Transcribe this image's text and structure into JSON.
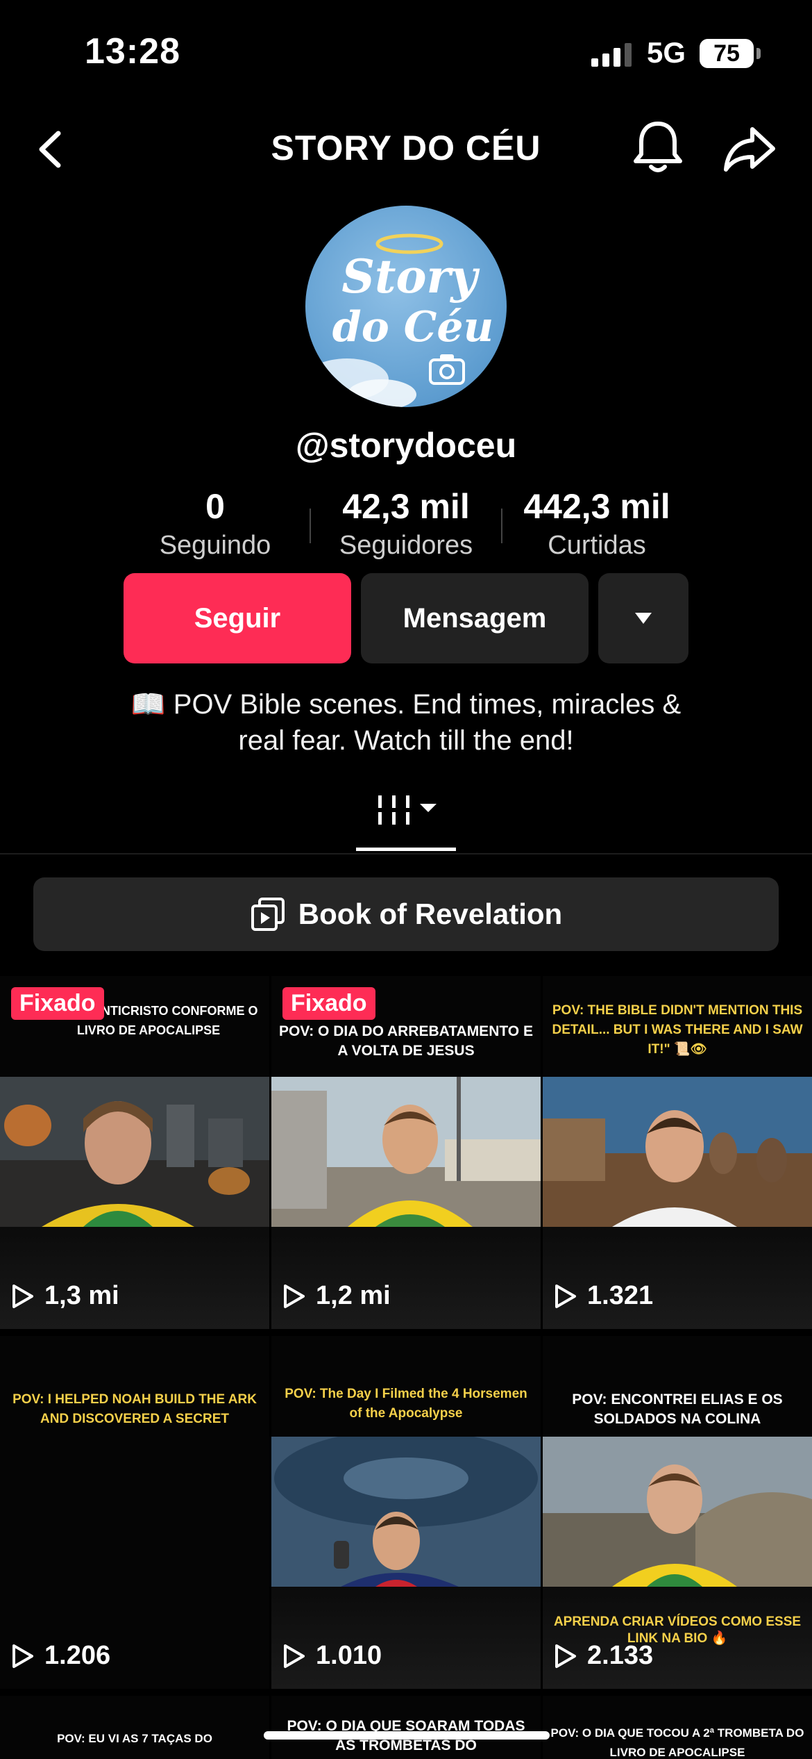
{
  "status_bar": {
    "time": "13:28",
    "network": "5G",
    "battery": "75"
  },
  "header": {
    "title": "STORY DO CÉU"
  },
  "profile": {
    "avatar_text_line1": "Story",
    "avatar_text_line2": "do Céu",
    "handle": "@storydoceu",
    "stats": [
      {
        "value": "0",
        "label": "Seguindo"
      },
      {
        "value": "42,3 mil",
        "label": "Seguidores"
      },
      {
        "value": "442,3 mil",
        "label": "Curtidas"
      }
    ],
    "follow_label": "Seguir",
    "message_label": "Mensagem",
    "bio_line1": "📖 POV Bible scenes. End times, miracles &",
    "bio_line2": "real fear. Watch till the end!"
  },
  "playlist": {
    "label": "Book of Revelation"
  },
  "videos": [
    {
      "pinned": "Fixado",
      "caption": "ADO DO ANTICRISTO CONFORME O LIVRO DE APOCALIPSE",
      "caption_color": "white",
      "views": "1,3 mi"
    },
    {
      "pinned": "Fixado",
      "caption": "POV: O DIA DO ARREBATAMENTO E A VOLTA DE JESUS",
      "caption_color": "white",
      "views": "1,2 mi"
    },
    {
      "pinned": "",
      "caption": "POV: THE BIBLE DIDN'T MENTION THIS DETAIL... BUT I WAS THERE AND I SAW IT!\" 📜👁",
      "caption_color": "yellow",
      "views": "1.321"
    },
    {
      "pinned": "",
      "caption": "POV: I HELPED NOAH BUILD THE ARK AND DISCOVERED A SECRET",
      "caption_color": "yellow",
      "views": "1.206"
    },
    {
      "pinned": "",
      "caption": "POV: The Day I Filmed the 4 Horsemen of the Apocalypse",
      "caption_color": "yellow",
      "views": "1.010"
    },
    {
      "pinned": "",
      "caption": "POV: ENCONTREI ELIAS E OS SOLDADOS NA COLINA",
      "caption_color": "white",
      "views": "2.133",
      "promo": "APRENDA CRIAR VÍDEOS COMO ESSE LINK NA BIO 🔥"
    },
    {
      "pinned": "",
      "caption": "POV: EU VI AS 7 TAÇAS DO",
      "caption_color": "white",
      "views": ""
    },
    {
      "pinned": "",
      "caption": "POV: O DIA QUE SOARAM TODAS AS TROMBETAS DO",
      "caption_color": "white",
      "views": ""
    },
    {
      "pinned": "",
      "caption": "POV: O DIA QUE TOCOU A 2ª TROMBETA DO LIVRO DE APOCALIPSE",
      "caption_color": "white",
      "views": ""
    }
  ],
  "colors": {
    "accent": "#fe2c55",
    "button_dark": "#222222",
    "caption_yellow": "#f5d04a"
  },
  "icons": [
    "back-icon",
    "bell-icon",
    "share-icon",
    "camera-icon",
    "dropdown-icon",
    "grid-tab-icon",
    "playlist-icon",
    "play-icon"
  ]
}
